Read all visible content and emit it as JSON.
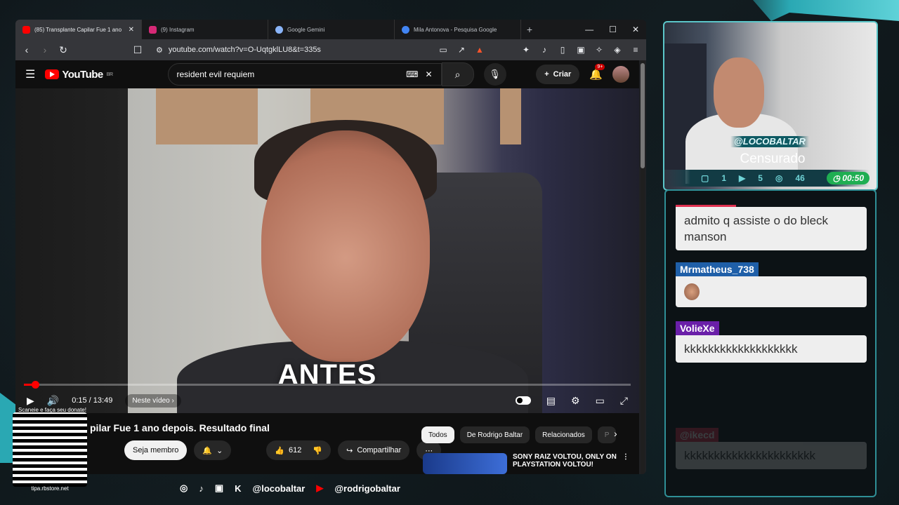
{
  "browser": {
    "tabs": [
      {
        "label": "(85) Transplante Capilar Fue 1 ano",
        "color": "#ff0000",
        "active": true
      },
      {
        "label": "(9) Instagram",
        "color": "#d62976",
        "active": false
      },
      {
        "label": "Google Gemini",
        "color": "#8ab4f8",
        "active": false
      },
      {
        "label": "Mila Antonova - Pesquisa Google",
        "color": "#4285f4",
        "active": false
      }
    ],
    "url": "youtube.com/watch?v=O-UqtgklLU8&t=335s"
  },
  "youtube": {
    "logo_text": "YouTube",
    "region": "BR",
    "search_query": "resident evil requiem",
    "create_label": "Criar",
    "notif_badge": "9+",
    "video_overlay_text": "ANTES",
    "progress_fraction": 0.019,
    "time": "0:15 / 13:49",
    "chapter": "Neste vídeo",
    "title": "pilar Fue 1 ano depois. Resultado final",
    "member_label": "Seja membro",
    "likes": "612",
    "share_label": "Compartilhar",
    "chips": [
      "Todos",
      "De Rodrigo Baltar",
      "Relacionados",
      "P"
    ],
    "rec_title_1": "SONY RAIZ VOLTOU, ONLY ON",
    "rec_title_2": "PLAYSTATION VOLTOU!"
  },
  "stream": {
    "handle": "@LOCOBALTAR",
    "status": "Censurado",
    "stats": [
      "1",
      "5",
      "46"
    ],
    "timer": "00:50",
    "chat": [
      {
        "name": "",
        "text": "admito q assiste o do bleck manson",
        "color": "#e03050"
      },
      {
        "name": "Mrmatheus_738",
        "text": "",
        "color": "#1f5fa8"
      },
      {
        "name": "VolieXe",
        "text": "kkkkkkkkkkkkkkkkkkk",
        "color": "#6a1fa8"
      },
      {
        "name": "@ikecd",
        "text": "kkkkkkkkkkkkkkkkkkkkkk",
        "color": "#e03050"
      }
    ],
    "socials": [
      "@locobaltar",
      "@rodrigobaltar"
    ],
    "qr_top": "Scaneie e faça seu donate!",
    "qr_bottom": "tipa.rbstore.net"
  }
}
